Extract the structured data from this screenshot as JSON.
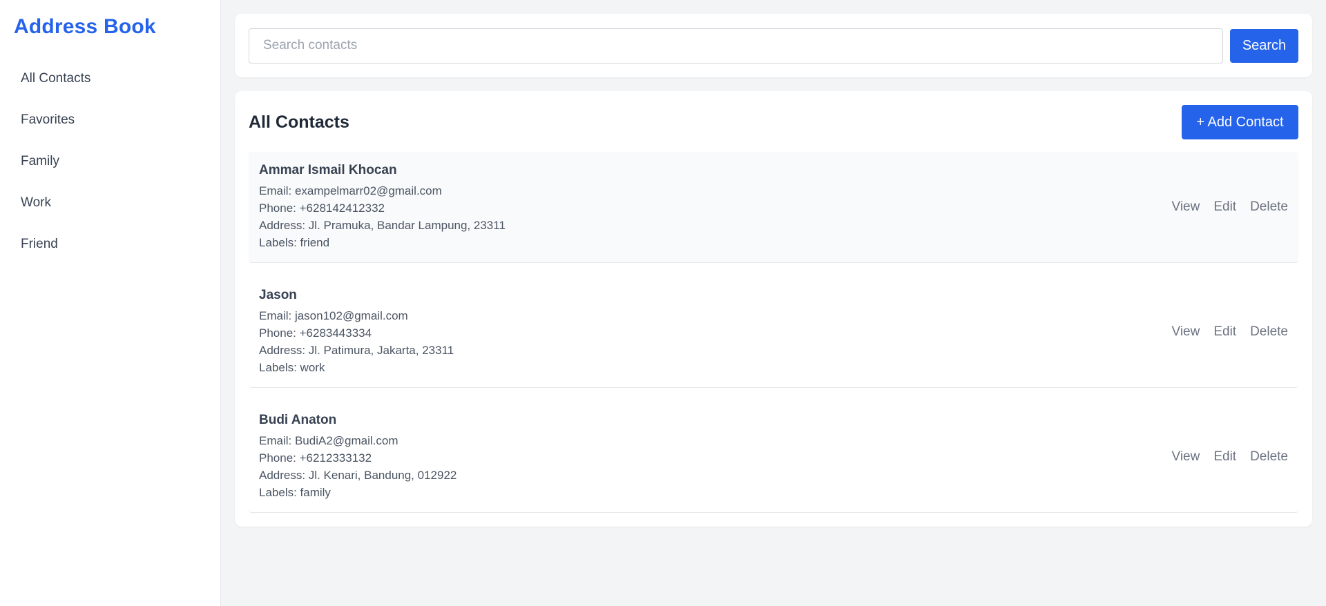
{
  "sidebar": {
    "title": "Address Book",
    "items": [
      {
        "label": "All Contacts"
      },
      {
        "label": "Favorites"
      },
      {
        "label": "Family"
      },
      {
        "label": "Work"
      },
      {
        "label": "Friend"
      }
    ]
  },
  "search": {
    "placeholder": "Search contacts",
    "value": "",
    "button_label": "Search"
  },
  "contacts_section": {
    "title": "All Contacts",
    "add_button_label": "+ Add Contact"
  },
  "contacts": [
    {
      "name": "Ammar Ismail Khocan",
      "email": "Email: exampelmarr02@gmail.com",
      "phone": "Phone: +628142412332",
      "address": "Address: Jl. Pramuka, Bandar Lampung, 23311",
      "labels": "Labels: friend",
      "actions": {
        "view": "View",
        "edit": "Edit",
        "delete": "Delete"
      }
    },
    {
      "name": "Jason",
      "email": "Email: jason102@gmail.com",
      "phone": "Phone: +6283443334",
      "address": "Address: Jl. Patimura, Jakarta, 23311",
      "labels": "Labels: work",
      "actions": {
        "view": "View",
        "edit": "Edit",
        "delete": "Delete"
      }
    },
    {
      "name": "Budi Anaton",
      "email": "Email: BudiA2@gmail.com",
      "phone": "Phone: +6212333132",
      "address": "Address: Jl. Kenari, Bandung, 012922",
      "labels": "Labels: family",
      "actions": {
        "view": "View",
        "edit": "Edit",
        "delete": "Delete"
      }
    }
  ],
  "colors": {
    "brand": "#2563eb",
    "background": "#f3f4f6",
    "card": "#ffffff",
    "row_highlight": "#f9fafb"
  }
}
